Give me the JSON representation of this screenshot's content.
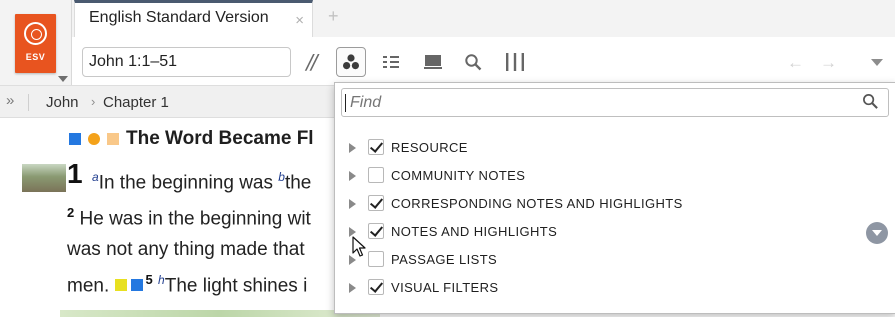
{
  "book_badge": {
    "abbr": "ESV",
    "color": "#e8541f"
  },
  "tabs": [
    {
      "title": "English Standard Version",
      "close": "×"
    }
  ],
  "tab_add": "+",
  "toolbar": {
    "reference_value": "John 1:1–51",
    "parallel_label": "//",
    "icons": [
      "visual-filters-icon",
      "layout-icon",
      "display-icon",
      "search-icon",
      "columns-icon"
    ],
    "nav_back": "←",
    "nav_forward": "→"
  },
  "breadcrumb": {
    "expand": "»",
    "book": "John",
    "separator": "›",
    "chapter": "Chapter 1"
  },
  "content": {
    "heading": "The Word Became Fl",
    "verse1_num": "1",
    "line1_fn_a": "a",
    "line1_text1": "In the beginning was ",
    "line1_fn_b": "b",
    "line1_text2": "the",
    "line2_vnum": "2",
    "line2_text": " He was in the beginning wit",
    "line3_text": "was not any thing made that",
    "line4_text1": "men. ",
    "line4_vnum": "5",
    "line4_fn": "h",
    "line4_text2": "The light shines i",
    "highlight_colors": [
      "#2478e0",
      "#f4a21a",
      "#f9c889",
      "#e8e020"
    ]
  },
  "filter_panel": {
    "find_placeholder": "Find",
    "items": [
      {
        "label": "RESOURCE",
        "checked": true
      },
      {
        "label": "COMMUNITY NOTES",
        "checked": false
      },
      {
        "label": "CORRESPONDING NOTES AND HIGHLIGHTS",
        "checked": true
      },
      {
        "label": "NOTES AND HIGHLIGHTS",
        "checked": true
      },
      {
        "label": "PASSAGE LISTS",
        "checked": false
      },
      {
        "label": "VISUAL FILTERS",
        "checked": true
      }
    ]
  }
}
